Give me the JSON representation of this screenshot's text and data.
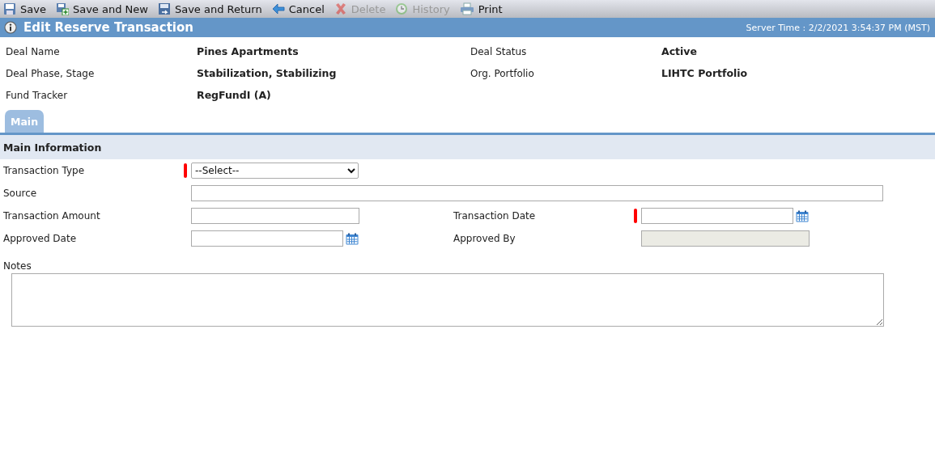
{
  "toolbar": [
    {
      "label": "Save",
      "disabled": false
    },
    {
      "label": "Save and New",
      "disabled": false
    },
    {
      "label": "Save and Return",
      "disabled": false
    },
    {
      "label": "Cancel",
      "disabled": false
    },
    {
      "label": "Delete",
      "disabled": true
    },
    {
      "label": "History",
      "disabled": true
    },
    {
      "label": "Print",
      "disabled": false
    }
  ],
  "header": {
    "title": "Edit Reserve Transaction",
    "server_time": "Server Time : 2/2/2021 3:54:37 PM (MST)"
  },
  "deal_info": [
    {
      "label": "Deal Name",
      "value": "Pines Apartments"
    },
    {
      "label": "Deal Status",
      "value": "Active"
    },
    {
      "label": "Deal Phase, Stage",
      "value": "Stabilization, Stabilizing"
    },
    {
      "label": "Org. Portfolio",
      "value": "LIHTC Portfolio"
    },
    {
      "label": "Fund Tracker",
      "value": "RegFundI (A)"
    }
  ],
  "tabs": [
    {
      "label": "Main",
      "selected": true
    }
  ],
  "section": {
    "title": "Main Information"
  },
  "form_rows": [
    [
      {
        "label": "Transaction Type",
        "kind": "select",
        "value": "--Select--",
        "required": true,
        "disabled": false
      }
    ],
    [
      {
        "label": "Source",
        "kind": "wide",
        "required": false,
        "disabled": false
      }
    ],
    [
      {
        "label": "Transaction Amount",
        "kind": "text",
        "required": false,
        "disabled": false
      },
      {
        "label": "Transaction Date",
        "kind": "date",
        "required": true,
        "disabled": false
      }
    ],
    [
      {
        "label": "Approved Date",
        "kind": "date",
        "required": false,
        "disabled": false
      },
      {
        "label": "Approved By",
        "kind": "text",
        "required": false,
        "disabled": true
      }
    ]
  ],
  "notes": {
    "label": "Notes"
  }
}
